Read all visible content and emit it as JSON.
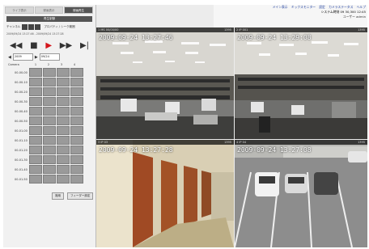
{
  "tabs": [
    "ライブ表示",
    "録画表示",
    "録画再生"
  ],
  "panel_title": "再生制御",
  "camera_select": {
    "label": "チャンネル",
    "hint": "プロパティ / シーク範囲"
  },
  "sub_text": "2009/09/24 13:27:46 - 2009/09/24 13:27:28",
  "date": {
    "value": "2009",
    "value2": "09/24"
  },
  "grid_header": [
    "Camera",
    "1",
    "2",
    "3",
    "4"
  ],
  "time_rows": [
    "00-00-00",
    "00-00-10",
    "00-00-20",
    "00-00-30",
    "00-00-40",
    "00-00-50",
    "00-01-00",
    "00-01-10",
    "00-01-20",
    "00-01-30",
    "00-01-40",
    "00-01-50"
  ],
  "buttons": {
    "ok": "適用",
    "reset": "フィーダー設定"
  },
  "header": {
    "links": [
      "メイン表示",
      "ミックスモニター",
      "設定",
      "カメラステータス",
      "ヘルプ"
    ],
    "status": "システム時刻 09 30,300 12:45",
    "user": "ユーザー admin"
  },
  "cameras": [
    {
      "label": "1",
      "bar": "MS 00/00/00",
      "right": "1395",
      "timestamp": "2009-09-24 13:27:46"
    },
    {
      "label": "2",
      "bar": "IP 001",
      "right": "1395",
      "timestamp": "2009-09-24 13:29:08"
    },
    {
      "label": "3",
      "bar": "IP 03",
      "right": "1395",
      "timestamp": "2009-09-24 13:27:28"
    },
    {
      "label": "4",
      "bar": "IP 04",
      "right": "1395",
      "timestamp": "2009-09-24 13:27:08"
    }
  ],
  "icons": [
    "rewind-icon",
    "stop-icon",
    "play-icon",
    "fast-forward-icon",
    "next-frame-icon"
  ],
  "colors": {
    "play": "#d4161c",
    "panel_dark": "#555555",
    "link": "#1a3c9e"
  }
}
